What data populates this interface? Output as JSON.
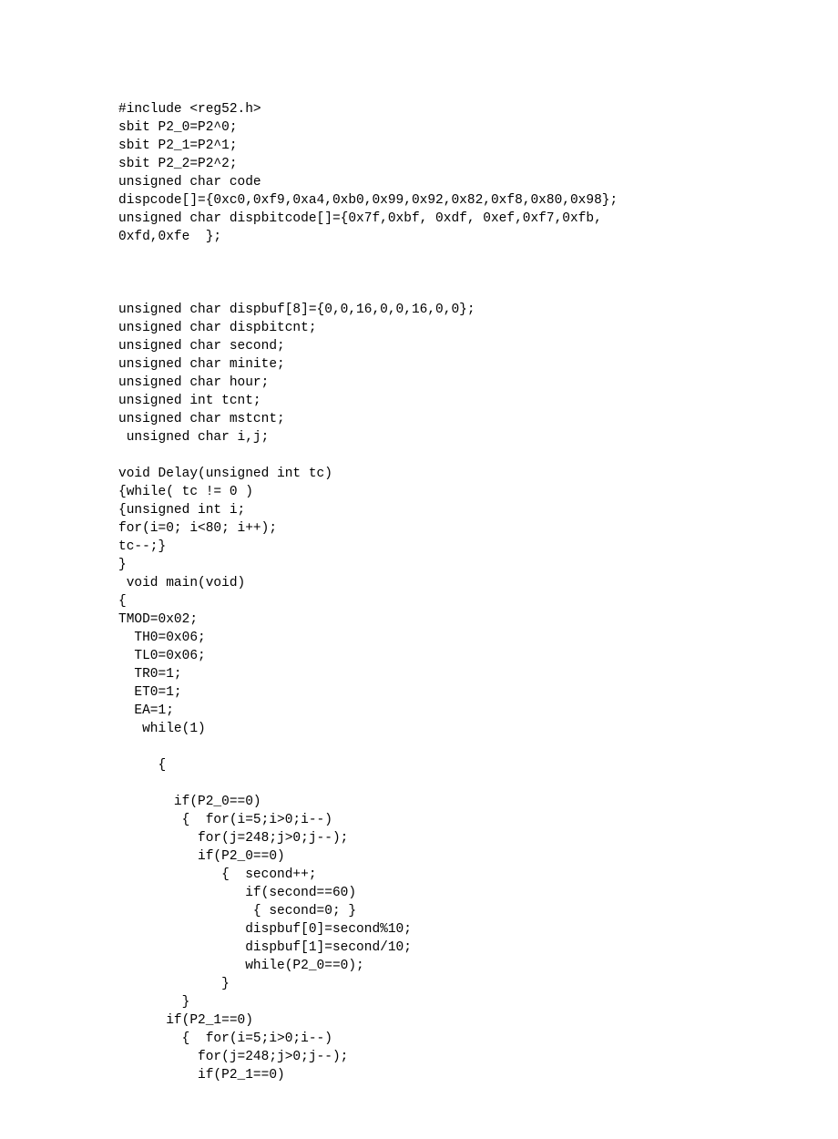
{
  "code": "#include <reg52.h>\nsbit P2_0=P2^0;\nsbit P2_1=P2^1;\nsbit P2_2=P2^2;\nunsigned char code\ndispcode[]={0xc0,0xf9,0xa4,0xb0,0x99,0x92,0x82,0xf8,0x80,0x98};\nunsigned char dispbitcode[]={0x7f,0xbf, 0xdf, 0xef,0xf7,0xfb,\n0xfd,0xfe  };\n\n\n\nunsigned char dispbuf[8]={0,0,16,0,0,16,0,0};\nunsigned char dispbitcnt;\nunsigned char second;\nunsigned char minite;\nunsigned char hour;\nunsigned int tcnt;\nunsigned char mstcnt;\n unsigned char i,j;\n\nvoid Delay(unsigned int tc)\n{while( tc != 0 )\n{unsigned int i;\nfor(i=0; i<80; i++);\ntc--;}\n}\n void main(void)\n{\nTMOD=0x02;\n  TH0=0x06;\n  TL0=0x06;\n  TR0=1;\n  ET0=1;\n  EA=1;\n   while(1)\n\n     {\n\n       if(P2_0==0)\n        {  for(i=5;i>0;i--)\n          for(j=248;j>0;j--);\n          if(P2_0==0)\n             {  second++;\n                if(second==60)\n                 { second=0; }\n                dispbuf[0]=second%10;\n                dispbuf[1]=second/10;\n                while(P2_0==0);\n             }\n        }\n      if(P2_1==0)\n        {  for(i=5;i>0;i--)\n          for(j=248;j>0;j--);\n          if(P2_1==0)"
}
